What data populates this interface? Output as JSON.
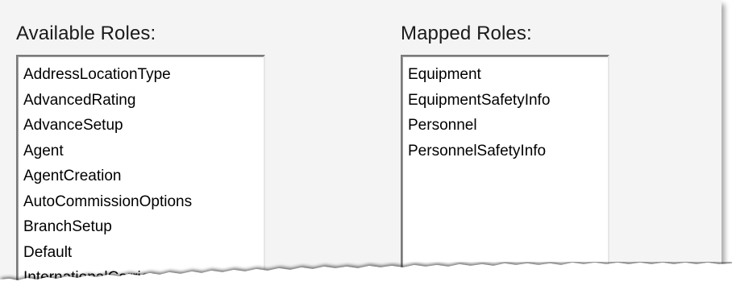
{
  "available": {
    "label": "Available Roles:",
    "items": [
      "AddressLocationType",
      "AdvancedRating",
      "AdvanceSetup",
      "Agent",
      "AgentCreation",
      "AutoCommissionOptions",
      "BranchSetup",
      "Default",
      "InternationalCarrier"
    ]
  },
  "mapped": {
    "label": "Mapped Roles:",
    "items": [
      "Equipment",
      "EquipmentSafetyInfo",
      "Personnel",
      "PersonnelSafetyInfo"
    ]
  },
  "colors": {
    "background": "#f4f4f4",
    "listbox": "#ffffff",
    "text": "#000000"
  }
}
